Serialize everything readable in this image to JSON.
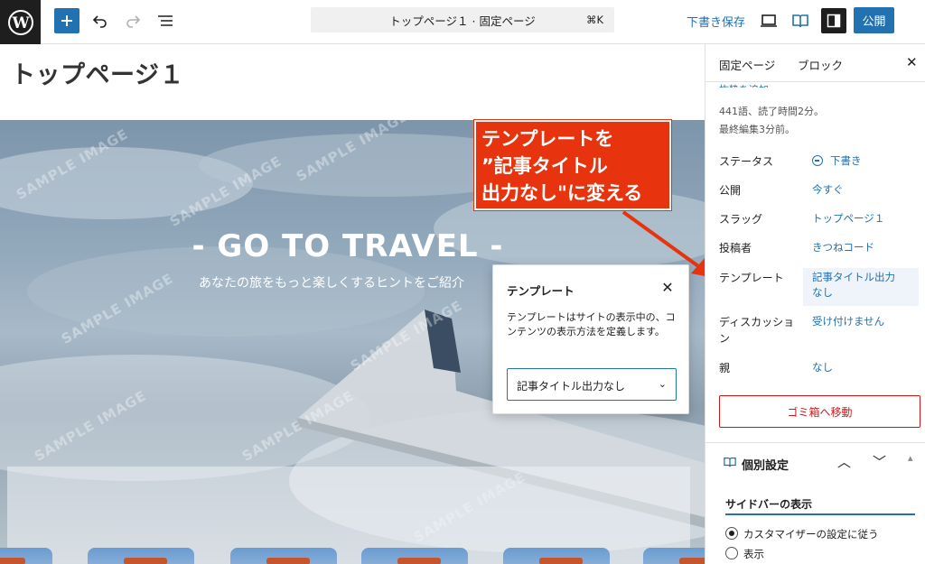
{
  "toolbar": {
    "document_title": "トップページ１ · 固定ページ",
    "shortcut": "⌘K",
    "save_draft": "下書き保存",
    "publish": "公開",
    "icons": [
      "wordpress-logo",
      "plus-icon",
      "undo-icon",
      "redo-icon",
      "list-view-icon",
      "desktop-preview-icon",
      "book-view-icon",
      "sidebar-toggle-icon"
    ]
  },
  "canvas": {
    "page_title": "トップページ１",
    "hero_title": "- GO TO TRAVEL -",
    "hero_subtitle": "あなたの旅をもっと楽しくするヒントをご紹介",
    "watermark_text": "SAMPLE IMAGE"
  },
  "annotation": {
    "lines": [
      "テンプレートを",
      "”記事タイトル",
      "出力なし\"に変える"
    ],
    "color": "#e8340e"
  },
  "popover": {
    "title": "テンプレート",
    "description": "テンプレートはサイトの表示中の、コンテンツの表示方法を定義します。",
    "selected": "記事タイトル出力なし"
  },
  "sidebar": {
    "tabs": [
      "固定ページ",
      "ブロック"
    ],
    "excerpt_link": "抜粋を追加...",
    "word_count": "441語、読了時間2分。",
    "last_edited": "最終編集3分前。",
    "rows": [
      {
        "label": "ステータス",
        "value": "下書き"
      },
      {
        "label": "公開",
        "value": "今すぐ"
      },
      {
        "label": "スラッグ",
        "value": "トップページ１"
      },
      {
        "label": "投稿者",
        "value": "きつねコード"
      },
      {
        "label": "テンプレート",
        "value": "記事タイトル出力なし"
      },
      {
        "label": "ディスカッション",
        "value": "受け付けません"
      },
      {
        "label": "親",
        "value": "なし"
      }
    ],
    "trash": "ゴミ箱へ移動",
    "section_title": "個別設定",
    "sidebar_display_title": "サイドバーの表示",
    "radio_options": [
      "カスタマイザーの設定に従う",
      "表示"
    ],
    "accent_color": "#2271b1",
    "danger_color": "#cc1818"
  }
}
